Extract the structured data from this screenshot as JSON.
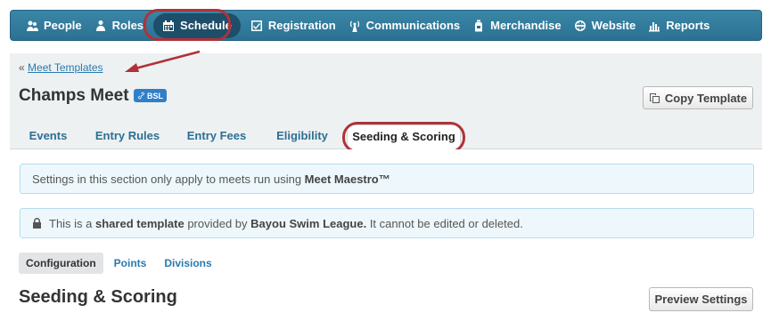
{
  "nav": {
    "items": [
      {
        "label": "People",
        "icon": "people-icon"
      },
      {
        "label": "Roles",
        "icon": "roles-icon"
      },
      {
        "label": "Schedule",
        "icon": "calendar-icon",
        "active": true
      },
      {
        "label": "Registration",
        "icon": "checkbox-icon"
      },
      {
        "label": "Communications",
        "icon": "broadcast-icon"
      },
      {
        "label": "Merchandise",
        "icon": "bottle-icon"
      },
      {
        "label": "Website",
        "icon": "globe-icon"
      },
      {
        "label": "Reports",
        "icon": "bar-chart-icon"
      }
    ]
  },
  "breadcrumb": {
    "prefix": "«",
    "link": "Meet Templates"
  },
  "page": {
    "title": "Champs Meet",
    "badge": "BSL"
  },
  "copy_button": "Copy Template",
  "tabs": [
    "Events",
    "Entry Rules",
    "Entry Fees",
    "Eligibility",
    "Seeding & Scoring"
  ],
  "alerts": {
    "maestro": {
      "pre": "Settings in this section only apply to meets run using ",
      "bold": "Meet Maestro™"
    },
    "shared": {
      "pre": "This is a ",
      "bold1": "shared template",
      "mid": " provided by ",
      "bold2": "Bayou Swim League.",
      "post": " It cannot be edited or deleted."
    }
  },
  "subtabs": [
    "Configuration",
    "Points",
    "Divisions"
  ],
  "section_title": "Seeding & Scoring",
  "preview_button": "Preview Settings",
  "colors": {
    "nav": "#2c7194",
    "highlight": "#b03237",
    "link": "#2a7ab0",
    "alert_bg": "#eef8fc"
  }
}
